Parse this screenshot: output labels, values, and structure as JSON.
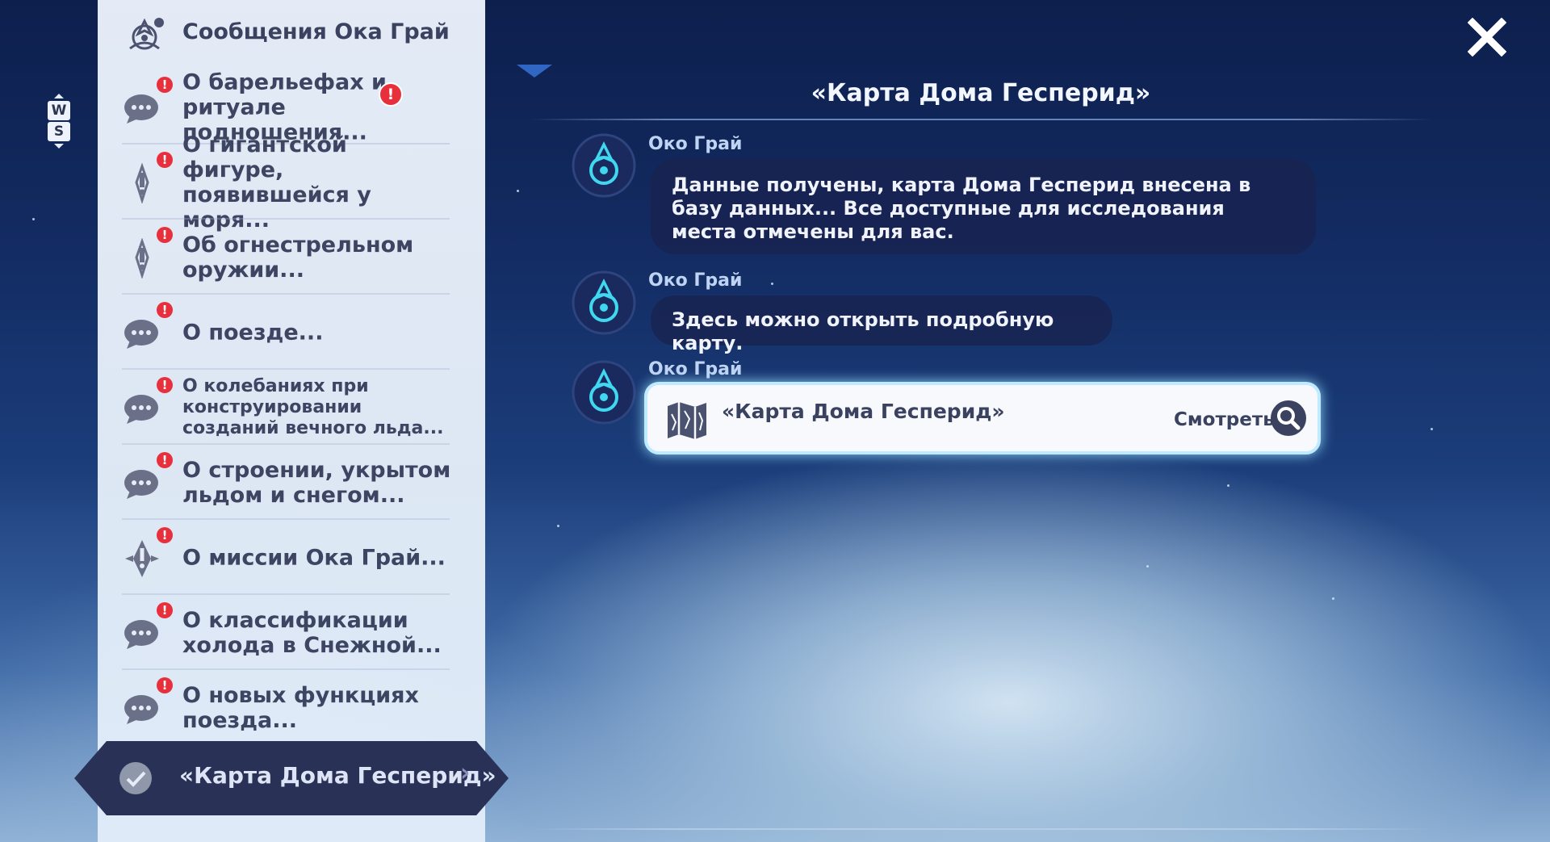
{
  "keys": {
    "up": "W",
    "down": "S"
  },
  "sidebar": {
    "header": "Сообщения Ока Грай",
    "items": [
      {
        "label": "О барельефах и ритуале подношения...",
        "icon": "chat-bubble-icon",
        "badge": "!"
      },
      {
        "label": "О гигантской фигуре, появившейся у моря...",
        "icon": "quest-marker-icon",
        "badge": "!"
      },
      {
        "label": "Об огнестрельном оружии...",
        "icon": "quest-marker-icon",
        "badge": "!"
      },
      {
        "label": "О поезде...",
        "icon": "chat-bubble-icon",
        "badge": "!"
      },
      {
        "label": "О колебаниях при конструировании созданий вечного льда...",
        "icon": "chat-bubble-icon",
        "badge": "!"
      },
      {
        "label": "О строении, укрытом льдом и снегом...",
        "icon": "chat-bubble-icon",
        "badge": "!"
      },
      {
        "label": "О миссии Ока Грай...",
        "icon": "diamond-marker-icon",
        "badge": "!"
      },
      {
        "label": "О классификации холода в Снежной...",
        "icon": "chat-bubble-icon",
        "badge": "!"
      },
      {
        "label": "О новых функциях поезда...",
        "icon": "chat-bubble-icon",
        "badge": "!"
      }
    ],
    "floating_badge": "!",
    "selected": {
      "label": "«Карта Дома Гесперид»",
      "icon": "checkmark-icon"
    }
  },
  "conversation": {
    "title": "«Карта Дома Гесперид»",
    "messages": [
      {
        "sender": "Око Грай",
        "text": "Данные получены, карта Дома Гесперид внесена в базу данных... Все доступные для исследования места отмечены для вас."
      },
      {
        "sender": "Око Грай",
        "text": "Здесь можно открыть подробную карту."
      },
      {
        "sender": "Око Грай",
        "card": {
          "title": "«Карта Дома Гесперид»",
          "action": "Смотреть"
        }
      }
    ]
  },
  "colors": {
    "accent": "#3a4260",
    "badge": "#e8303c",
    "card_glow": "#bfeaff"
  }
}
